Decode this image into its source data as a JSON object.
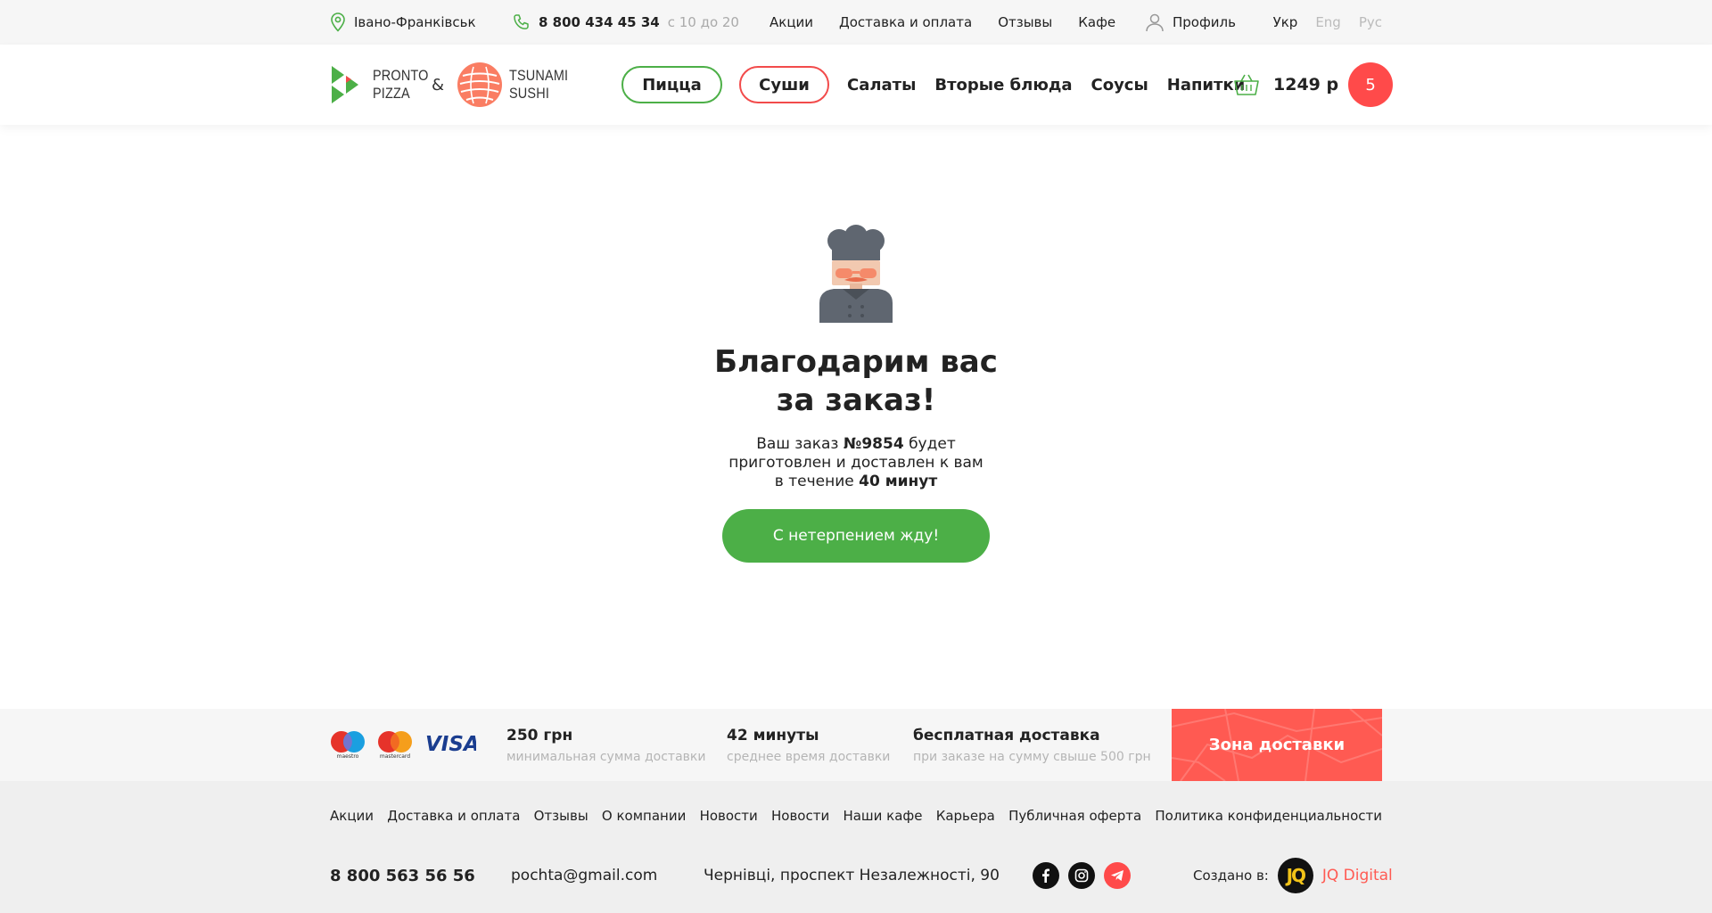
{
  "topbar": {
    "city": "Івано-Франківськ",
    "phone": "8 800 434 45 34",
    "hours": "с 10 до 20",
    "links": [
      "Акции",
      "Доставка и оплата",
      "Отзывы",
      "Кафе"
    ],
    "profile": "Профиль",
    "languages": [
      {
        "label": "Укр",
        "active": true
      },
      {
        "label": "Eng",
        "active": false
      },
      {
        "label": "Рус",
        "active": false
      }
    ]
  },
  "header": {
    "logo_pizza_line1": "PRONTO",
    "logo_pizza_line2": "PIZZA",
    "logo_amp": "&",
    "logo_sushi_line1": "TSUNAMI",
    "logo_sushi_line2": "SUSHI",
    "pill_pizza": "Пицца",
    "pill_sushi": "Суши",
    "nav": [
      "Салаты",
      "Вторые блюда",
      "Соусы",
      "Напитки"
    ],
    "cart_total": "1249 р",
    "cart_count": "5",
    "colors": {
      "green": "#4caf47",
      "red": "#f24b4b",
      "cart_badge": "#ff4a4a"
    }
  },
  "main": {
    "title_line1": "Благодарим вас",
    "title_line2": "за заказ!",
    "desc_prefix": "Ваш заказ ",
    "order_number": "№9854",
    "desc_middle": " будет приготовлен и доставлен к вам в течение ",
    "delivery_time": "40 минут",
    "cta_label": "С нетерпением жду!"
  },
  "info": {
    "payment_icons": [
      "maestro-icon",
      "mastercard-icon",
      "visa-icon"
    ],
    "maestro_label": "maestro",
    "mastercard_label": "mastercard",
    "visa_label": "VISA",
    "min_value": "250 грн",
    "min_sub": "минимальная сумма доставки",
    "avg_value": "42 минуты",
    "avg_sub": "среднее время доставки",
    "free_value": "бесплатная доставка",
    "free_sub": "при заказе на сумму свыше 500 грн",
    "zone_label": "Зона доставки",
    "zone_color": "#ff5a52"
  },
  "footer": {
    "links": [
      "Акции",
      "Доставка и оплата",
      "Отзывы",
      "О компании",
      "Новости",
      "Новости",
      "Наши кафе",
      "Карьера",
      "Публичная оферта",
      "Политика конфиденциальности"
    ],
    "phone": "8 800 563 56 56",
    "email": "pochta@gmail.com",
    "address": "Чернівці, проспект Незалежності, 90",
    "social": [
      "facebook-icon",
      "instagram-icon",
      "telegram-icon"
    ],
    "made_by": "Создано в:",
    "studio_logo": "JQ",
    "studio_name": "JQ Digital"
  }
}
